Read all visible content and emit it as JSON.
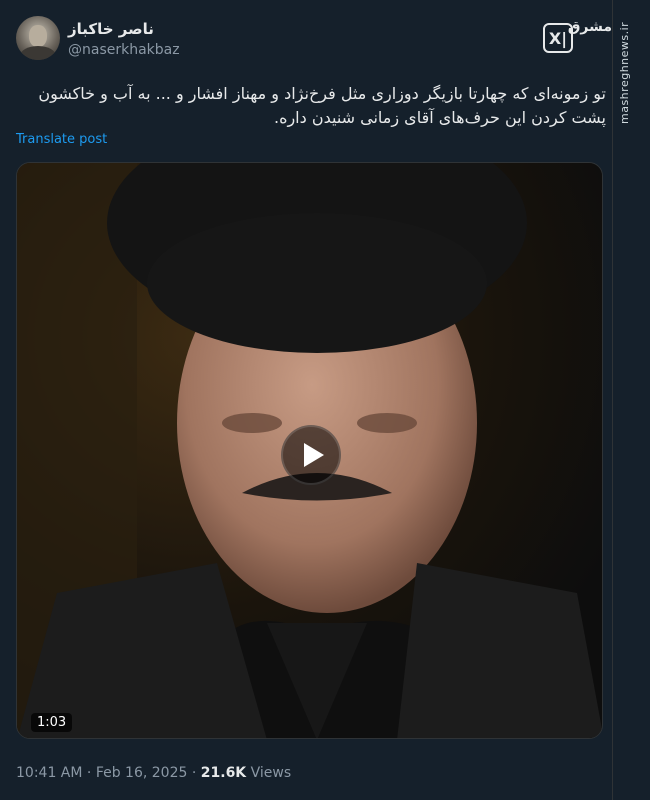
{
  "author": {
    "name": "ناصر خاکباز",
    "handle": "@naserkhakbaz",
    "avatar_icon": "avatar-photo"
  },
  "branding": {
    "x_logo_text": "X|",
    "site_mark": "مشرق",
    "side_watermark": "mashreghnews.ir"
  },
  "post": {
    "text": "تو زمونه‌ای که چهارتا بازیگر دوزاری مثل فرخ‌نژاد و مهناز افشار و ... به آب و خاکشون پشت کردن این حرف‌های آقای زمانی شنیدن داره.",
    "translate_label": "Translate post"
  },
  "media": {
    "duration": "1:03",
    "play_icon": "play-icon"
  },
  "footer": {
    "time": "10:41 AM",
    "separator": "·",
    "date": "Feb 16, 2025",
    "views_count": "21.6K",
    "views_label": "Views"
  },
  "colors": {
    "background": "#15202b",
    "text": "#e7e9ea",
    "muted": "#8b98a5",
    "link": "#1d9bf0"
  }
}
